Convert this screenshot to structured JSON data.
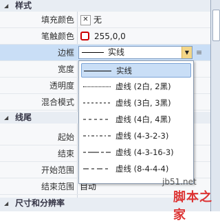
{
  "sections": {
    "style": "样式",
    "line_end": "线尾",
    "size": "尺寸和分辨率"
  },
  "rows": {
    "fill_color": {
      "label": "填充颜色",
      "value": "无"
    },
    "stroke_color": {
      "label": "笔触颜色",
      "value": "255,0,0"
    },
    "border": {
      "label": "边框",
      "value": "实线"
    },
    "width": {
      "label": "宽度"
    },
    "opacity": {
      "label": "透明度"
    },
    "blend": {
      "label": "混合模式"
    },
    "start": {
      "label": "起始"
    },
    "end": {
      "label": "结束"
    },
    "start_range": {
      "label": "开始范围"
    },
    "end_range": {
      "label": "结束范围",
      "value": "自动"
    }
  },
  "dropdown": {
    "options": [
      {
        "label": "实线",
        "style": "solid"
      },
      {
        "label": "虚线 (2白, 2黑)",
        "style": "dot"
      },
      {
        "label": "虚线 (3白, 3黑)",
        "style": "dash3"
      },
      {
        "label": "虚线 (4白, 4黑)",
        "style": "dash4"
      },
      {
        "label": "虚线 (4-3-2-3)",
        "style": "dashdot"
      },
      {
        "label": "虚线 (4-3-16-3)",
        "style": "longdashdot"
      },
      {
        "label": "虚线 (8-4-4-4)",
        "style": "longdash"
      }
    ],
    "selected_index": 0
  },
  "watermark": {
    "site": "jb51.net",
    "name": "脚本之家"
  },
  "colors": {
    "stroke": "#ff0000",
    "selection": "#c9def6",
    "combo_button": "#f3d688"
  }
}
